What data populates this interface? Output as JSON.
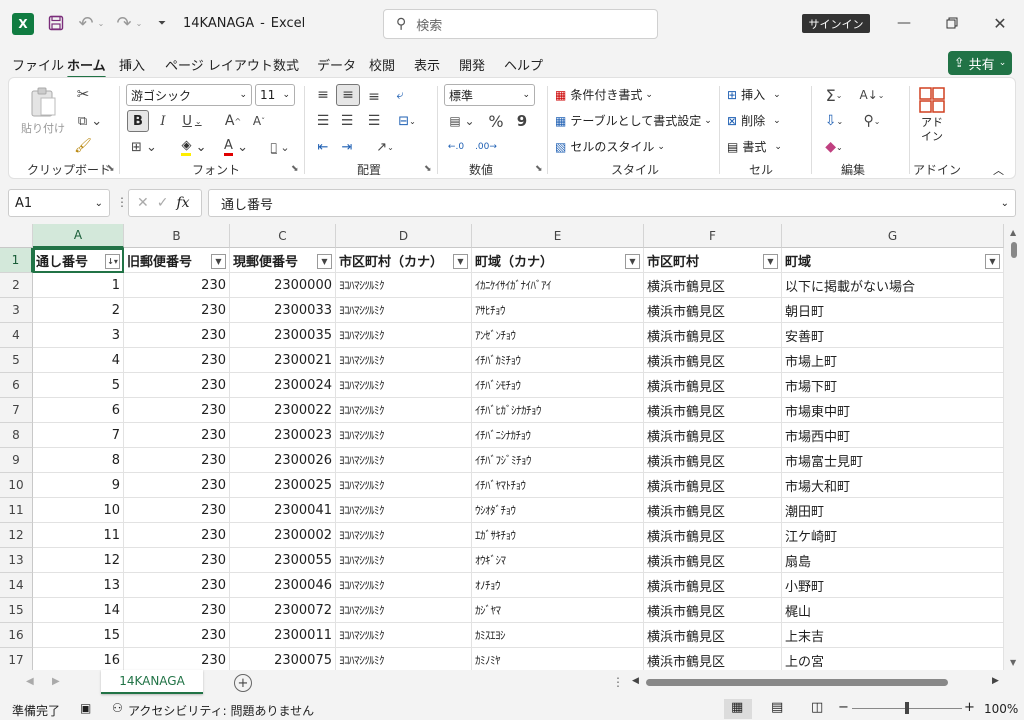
{
  "titlebar": {
    "app_letter": "X",
    "filename": "14KANAGA",
    "separator": "-",
    "app_name": "Excel",
    "search_placeholder": "検索",
    "signin_label": "サインイン"
  },
  "tabs": [
    "ファイル",
    "ホーム",
    "挿入",
    "ページ レイアウト",
    "数式",
    "データ",
    "校閲",
    "表示",
    "開発",
    "ヘルプ"
  ],
  "active_tab": "ホーム",
  "share_label": "共有",
  "ribbon": {
    "clipboard": {
      "paste": "貼り付け",
      "label": "クリップボード"
    },
    "font": {
      "family": "游ゴシック",
      "size": "11",
      "bold": "B",
      "italic": "I",
      "underline": "U",
      "grow": "A",
      "shrink": "A",
      "label": "フォント"
    },
    "alignment": {
      "label": "配置"
    },
    "number": {
      "format": "標準",
      "percent": "%",
      "comma": "9",
      "label": "数値"
    },
    "styles": {
      "conditional": "条件付き書式",
      "table": "テーブルとして書式設定",
      "cell_styles": "セルのスタイル",
      "label": "スタイル"
    },
    "cells": {
      "insert": "挿入",
      "delete": "削除",
      "format": "書式",
      "label": "セル"
    },
    "editing": {
      "label": "編集"
    },
    "addins": {
      "addin": "アド\nイン",
      "label": "アドイン"
    }
  },
  "formula_bar": {
    "cell_ref": "A1",
    "fx": "fx",
    "value": "通し番号"
  },
  "columns": [
    "A",
    "B",
    "C",
    "D",
    "E",
    "F",
    "G"
  ],
  "headers": [
    "通し番号",
    "旧郵便番号",
    "現郵便番号",
    "市区町村（カナ）",
    "町域（カナ）",
    "市区町村",
    "町域"
  ],
  "rows": [
    [
      "1",
      "230",
      "2300000",
      "ﾖｺﾊﾏｼﾂﾙﾐｸ",
      "ｲｶﾆｹｲｻｲｶﾞﾅｲﾊﾞｱｲ",
      "横浜市鶴見区",
      "以下に掲載がない場合"
    ],
    [
      "2",
      "230",
      "2300033",
      "ﾖｺﾊﾏｼﾂﾙﾐｸ",
      "ｱｻﾋﾁｮｳ",
      "横浜市鶴見区",
      "朝日町"
    ],
    [
      "3",
      "230",
      "2300035",
      "ﾖｺﾊﾏｼﾂﾙﾐｸ",
      "ｱﾝｾﾞﾝﾁｮｳ",
      "横浜市鶴見区",
      "安善町"
    ],
    [
      "4",
      "230",
      "2300021",
      "ﾖｺﾊﾏｼﾂﾙﾐｸ",
      "ｲﾁﾊﾞｶﾐﾁｮｳ",
      "横浜市鶴見区",
      "市場上町"
    ],
    [
      "5",
      "230",
      "2300024",
      "ﾖｺﾊﾏｼﾂﾙﾐｸ",
      "ｲﾁﾊﾞｼﾓﾁｮｳ",
      "横浜市鶴見区",
      "市場下町"
    ],
    [
      "6",
      "230",
      "2300022",
      "ﾖｺﾊﾏｼﾂﾙﾐｸ",
      "ｲﾁﾊﾞﾋｶﾞｼﾅｶﾁｮｳ",
      "横浜市鶴見区",
      "市場東中町"
    ],
    [
      "7",
      "230",
      "2300023",
      "ﾖｺﾊﾏｼﾂﾙﾐｸ",
      "ｲﾁﾊﾞﾆｼﾅｶﾁｮｳ",
      "横浜市鶴見区",
      "市場西中町"
    ],
    [
      "8",
      "230",
      "2300026",
      "ﾖｺﾊﾏｼﾂﾙﾐｸ",
      "ｲﾁﾊﾞﾌｼﾞﾐﾁｮｳ",
      "横浜市鶴見区",
      "市場富士見町"
    ],
    [
      "9",
      "230",
      "2300025",
      "ﾖｺﾊﾏｼﾂﾙﾐｸ",
      "ｲﾁﾊﾞﾔﾏﾄﾁｮｳ",
      "横浜市鶴見区",
      "市場大和町"
    ],
    [
      "10",
      "230",
      "2300041",
      "ﾖｺﾊﾏｼﾂﾙﾐｸ",
      "ｳｼｵﾀﾞﾁｮｳ",
      "横浜市鶴見区",
      "潮田町"
    ],
    [
      "11",
      "230",
      "2300002",
      "ﾖｺﾊﾏｼﾂﾙﾐｸ",
      "ｴｶﾞｻｷﾁｮｳ",
      "横浜市鶴見区",
      "江ケ崎町"
    ],
    [
      "12",
      "230",
      "2300055",
      "ﾖｺﾊﾏｼﾂﾙﾐｸ",
      "ｵｳｷﾞｼﾏ",
      "横浜市鶴見区",
      "扇島"
    ],
    [
      "13",
      "230",
      "2300046",
      "ﾖｺﾊﾏｼﾂﾙﾐｸ",
      "ｵﾉﾁｮｳ",
      "横浜市鶴見区",
      "小野町"
    ],
    [
      "14",
      "230",
      "2300072",
      "ﾖｺﾊﾏｼﾂﾙﾐｸ",
      "ｶｼﾞﾔﾏ",
      "横浜市鶴見区",
      "梶山"
    ],
    [
      "15",
      "230",
      "2300011",
      "ﾖｺﾊﾏｼﾂﾙﾐｸ",
      "ｶﾐｽｴﾖｼ",
      "横浜市鶴見区",
      "上末吉"
    ],
    [
      "16",
      "230",
      "2300075",
      "ﾖｺﾊﾏｼﾂﾙﾐｸ",
      "ｶﾐﾉﾐﾔ",
      "横浜市鶴見区",
      "上の宮"
    ]
  ],
  "row_numbers": [
    "1",
    "2",
    "3",
    "4",
    "5",
    "6",
    "7",
    "8",
    "9",
    "10",
    "11",
    "12",
    "13",
    "14",
    "15",
    "16",
    "17"
  ],
  "sheet_tab": "14KANAGA",
  "status": {
    "ready": "準備完了",
    "accessibility": "アクセシビリティ: 問題ありません",
    "zoom": "100%"
  },
  "colors": {
    "accent": "#217346",
    "excel_icon": "#107c41"
  }
}
